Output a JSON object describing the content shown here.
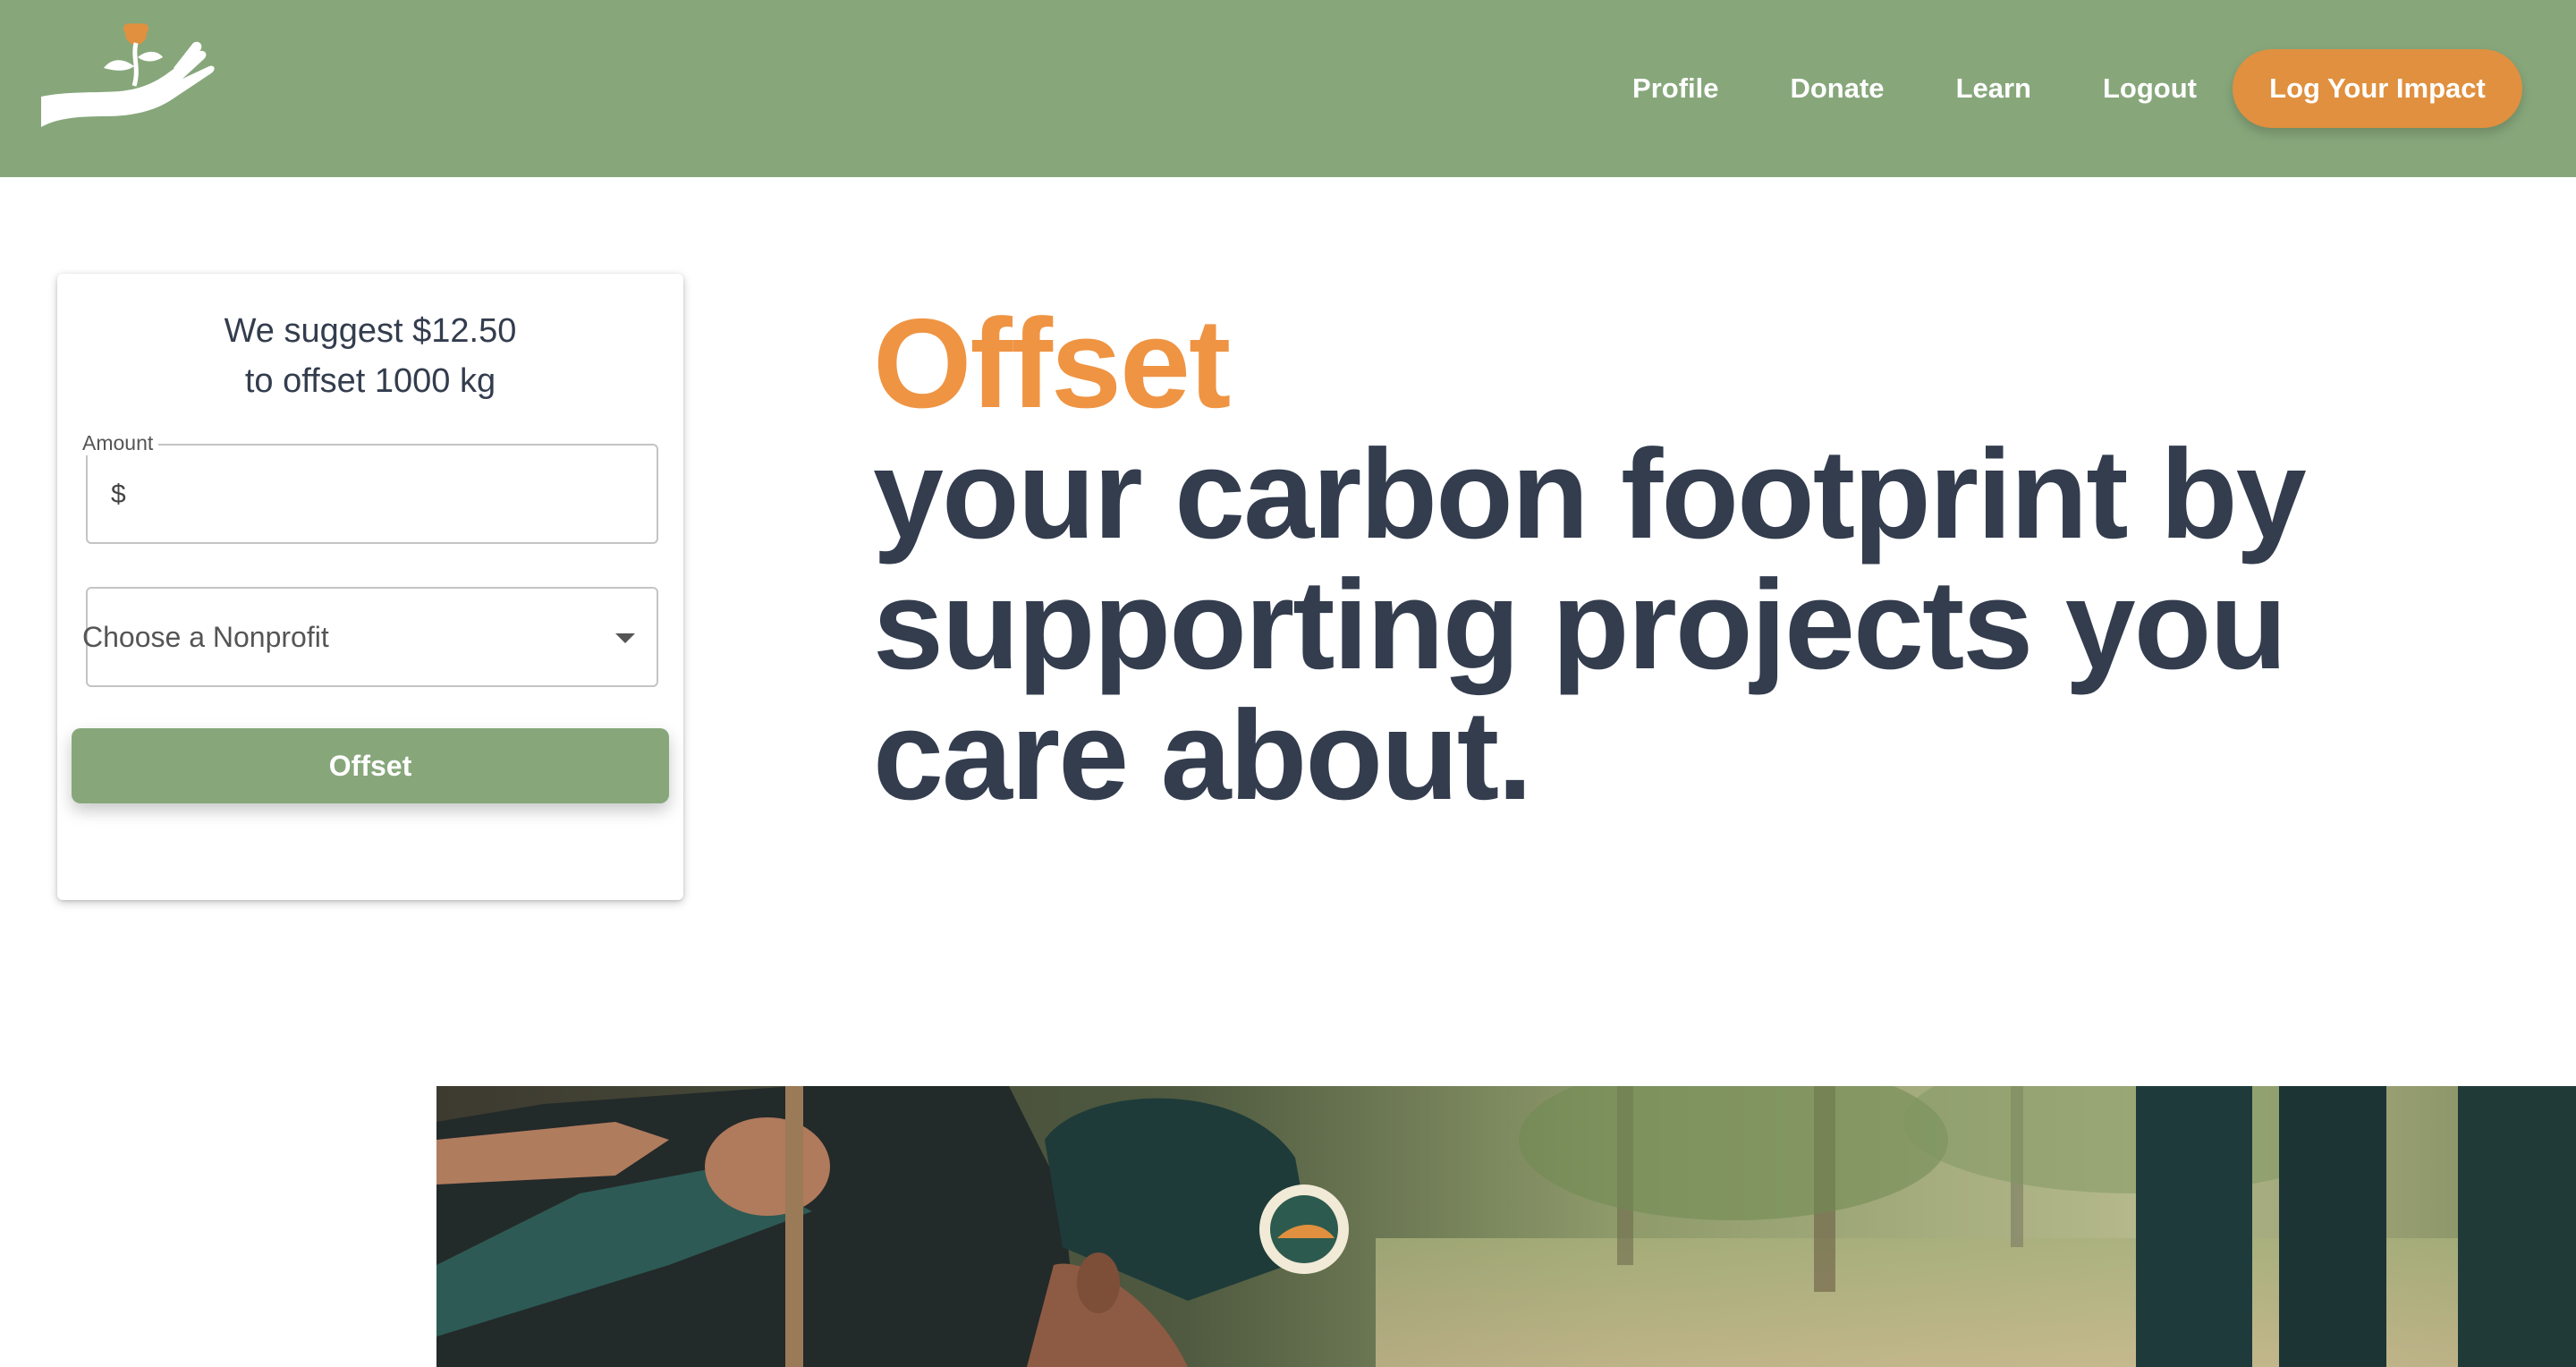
{
  "header": {
    "logo_icon": "hand-holding-plant-icon",
    "nav": [
      "Profile",
      "Donate",
      "Learn",
      "Logout"
    ],
    "cta_label": "Log Your Impact",
    "background": "#87a77b",
    "cta_color": "#e0903f"
  },
  "card": {
    "suggest_line1": "We suggest $12.50",
    "suggest_line2": "to offset 1000 kg",
    "amount_label": "Amount",
    "currency_symbol": "$",
    "amount_value": "",
    "nonprofit_placeholder": "Choose a Nonprofit",
    "submit_label": "Offset"
  },
  "hero": {
    "highlight": "Offset",
    "text": "your carbon footprint by supporting projects you care about.",
    "highlight_color": "#ef9443",
    "text_color": "#333d4e"
  },
  "photo": {
    "description_icon": "volunteers-planting-photo"
  }
}
